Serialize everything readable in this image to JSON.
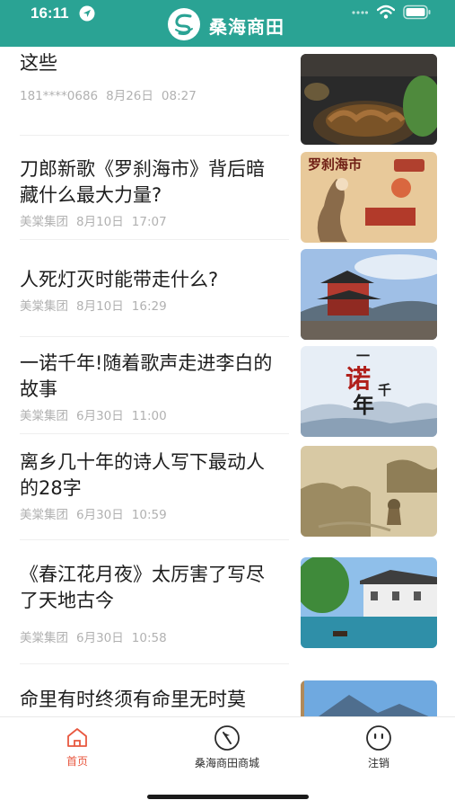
{
  "status_bar": {
    "time": "16:11"
  },
  "header": {
    "title": "桑海商田"
  },
  "feed": {
    "items": [
      {
        "title": "这些",
        "author": "181****0686",
        "date": "8月26日",
        "time": "08:27"
      },
      {
        "title": "刀郎新歌《罗刹海市》背后暗藏什么最大力量?",
        "author": "美棠集团",
        "date": "8月10日",
        "time": "17:07",
        "thumb_text": "罗刹海市"
      },
      {
        "title": "人死灯灭时能带走什么?",
        "author": "美棠集团",
        "date": "8月10日",
        "time": "16:29"
      },
      {
        "title": "一诺千年!随着歌声走进李白的故事",
        "author": "美棠集团",
        "date": "6月30日",
        "time": "11:00",
        "thumb_text": [
          "一",
          "诺",
          "千",
          "年"
        ]
      },
      {
        "title": "离乡几十年的诗人写下最动人的28字",
        "author": "美棠集团",
        "date": "6月30日",
        "time": "10:59"
      },
      {
        "title": "《春江花月夜》太厉害了写尽了天地古今",
        "author": "美棠集团",
        "date": "6月30日",
        "time": "10:58"
      },
      {
        "title": "命里有时终须有命里无时莫",
        "author": "",
        "date": "",
        "time": ""
      }
    ]
  },
  "tabbar": {
    "tabs": [
      {
        "label": "首页",
        "icon": "home-icon",
        "active": true
      },
      {
        "label": "桑海商田商城",
        "icon": "compass-icon",
        "active": false
      },
      {
        "label": "注销",
        "icon": "face-icon",
        "active": false
      }
    ],
    "active_color": "#e8573f"
  },
  "colors": {
    "header": "#2aa394",
    "meta_text": "#b1b1b1"
  }
}
